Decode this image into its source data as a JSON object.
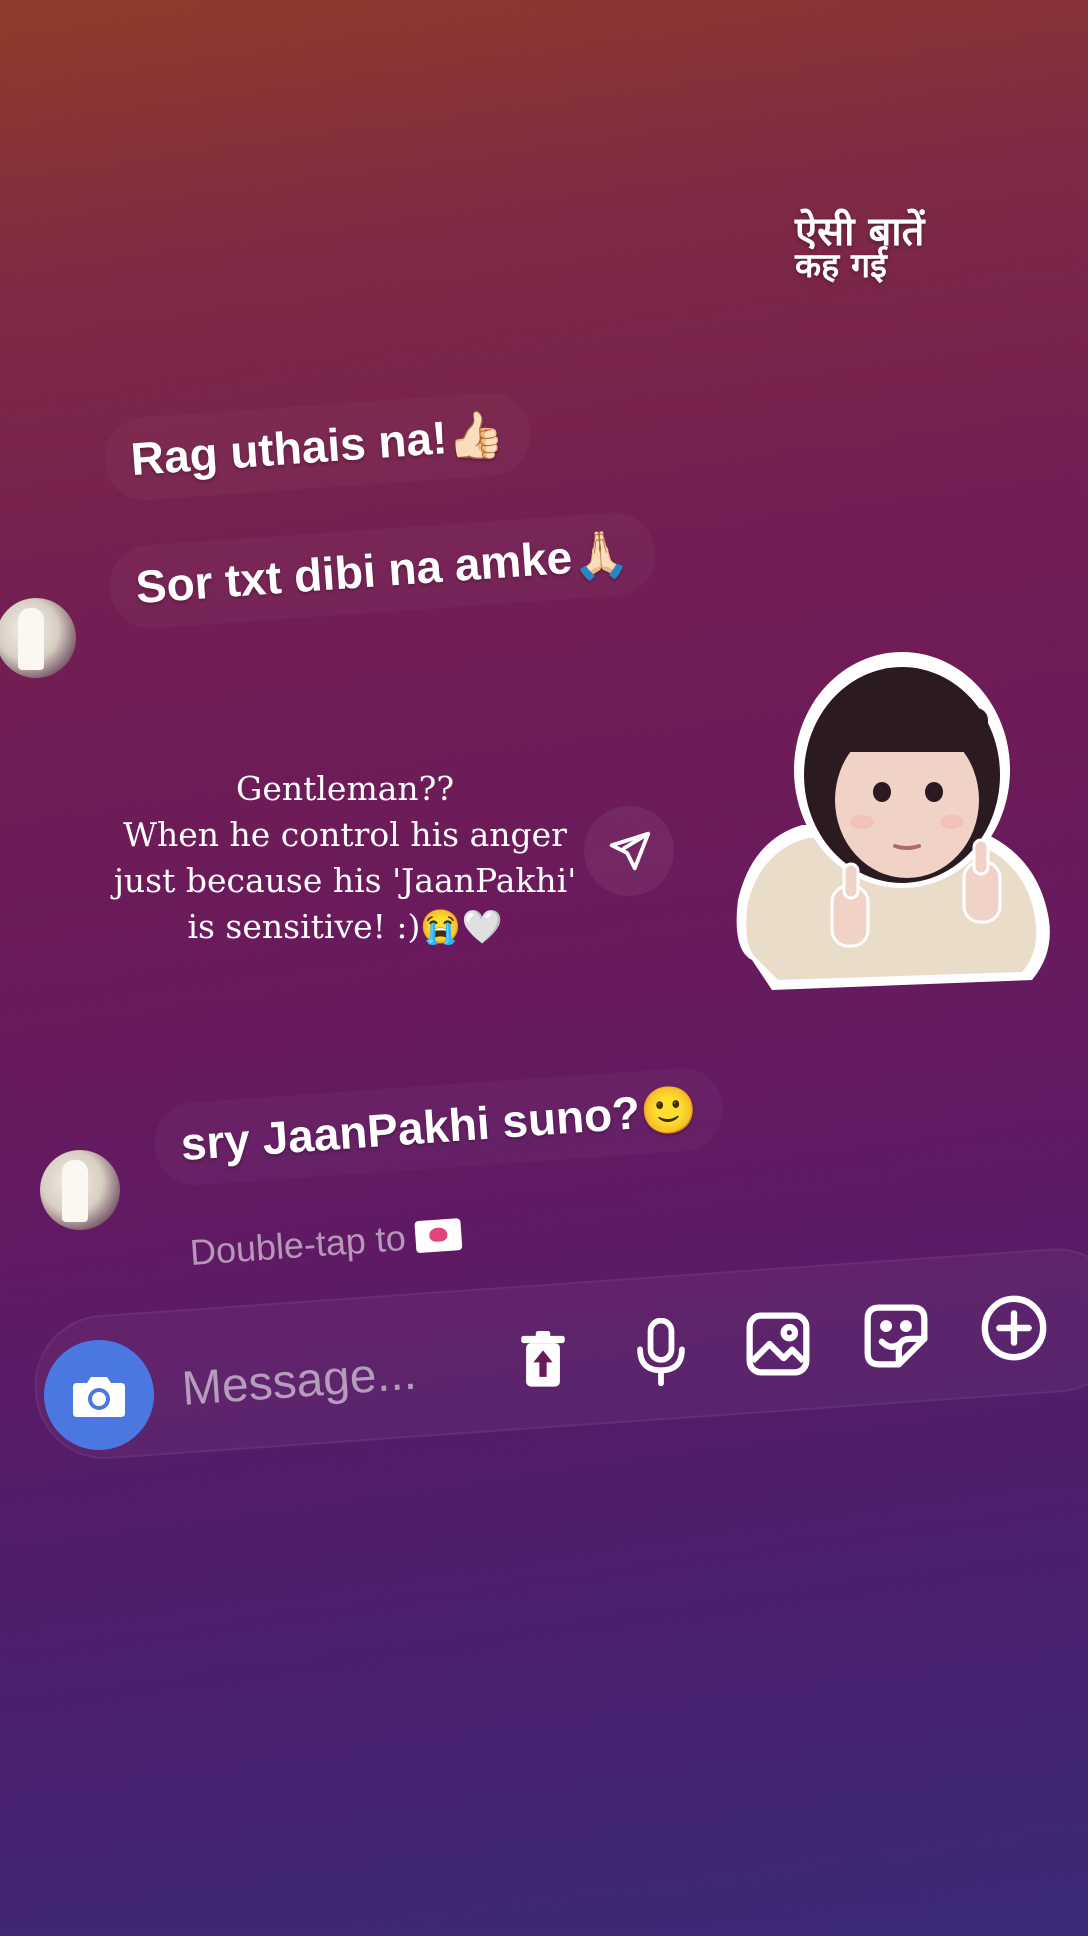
{
  "overlay": {
    "line1": "ऐसी बातें",
    "line2": "कह गई"
  },
  "messages": [
    {
      "text": "Rag uthais na!👍🏻"
    },
    {
      "text": "Sor txt dibi na amke🙏🏻"
    },
    {
      "text": "sry JaanPakhi suno?🙂"
    }
  ],
  "shared_post": {
    "lines": [
      "Gentleman??",
      "When he control his anger",
      "just because his 'JaanPakhi'",
      "is sensitive! :)😭🤍"
    ]
  },
  "hint": {
    "text": "Double-tap to"
  },
  "composer": {
    "placeholder": "Message..."
  },
  "icons": {
    "camera": "camera-icon",
    "delete": "trash-icon",
    "mic": "microphone-icon",
    "gallery": "image-icon",
    "sticker": "sticker-icon",
    "plus": "plus-circle-icon",
    "send": "send-icon"
  },
  "colors": {
    "camera_button": "#4a78e0",
    "heart": "#e0457b"
  }
}
